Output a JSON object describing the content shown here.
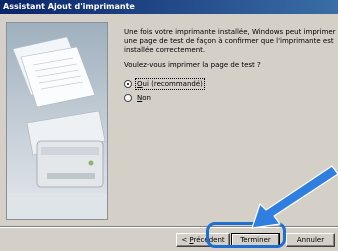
{
  "window": {
    "title": "Assistant Ajout d'imprimante"
  },
  "content": {
    "message": "Une fois votre imprimante installée, Windows peut imprimer une page de test de façon à confirmer que l'imprimante est installée correctement.",
    "question": "Voulez-vous imprimer la page de test ?",
    "options": [
      {
        "mnemonic": "O",
        "rest": "ui (recommandé)",
        "selected": true
      },
      {
        "mnemonic": "N",
        "rest": "on",
        "selected": false
      }
    ]
  },
  "buttons": {
    "back": {
      "prefix": "< ",
      "mnemonic": "P",
      "rest": "récédent"
    },
    "finish": "Terminer",
    "cancel": "Annuler"
  },
  "colors": {
    "titlebar": "#0a246a",
    "highlight": "#1e6fd0",
    "arrow": "#2f7fe0"
  }
}
